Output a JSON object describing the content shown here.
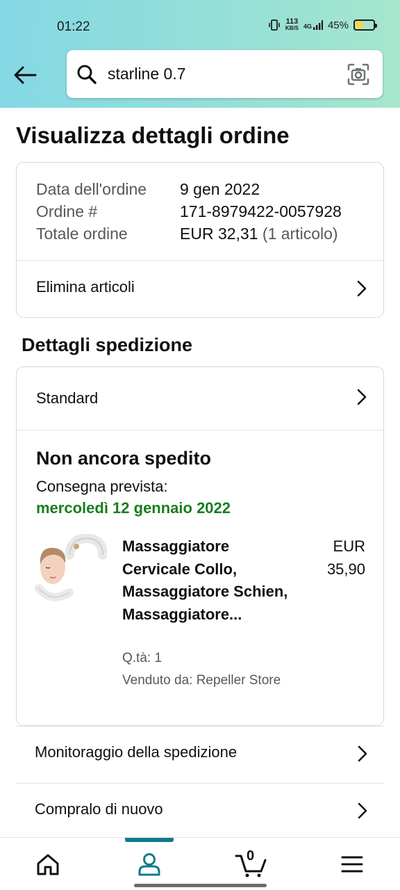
{
  "status_bar": {
    "time": "01:22",
    "speed_value": "113",
    "speed_unit": "KB/S",
    "network": "4G",
    "battery_percent": "45%",
    "battery_level": 0.45
  },
  "search": {
    "query": "starline 0.7"
  },
  "page": {
    "title": "Visualizza dettagli ordine"
  },
  "order_summary": {
    "date_label": "Data dell'ordine",
    "date_value": "9 gen 2022",
    "number_label": "Ordine #",
    "number_value": "171-8979422-0057928",
    "total_label": "Totale ordine",
    "total_value": "EUR 32,31",
    "total_items": "(1 articolo)",
    "delete_items_label": "Elimina articoli"
  },
  "shipping": {
    "section_title": "Dettagli spedizione",
    "method": "Standard",
    "status": "Non ancora spedito",
    "eta_label": "Consegna prevista:",
    "eta_date": "mercoledì 12 gennaio 2022",
    "product": {
      "title": "Massaggiatore Cervicale Collo, Massaggiatore Schien, Massaggiatore...",
      "price_currency": "EUR",
      "price_value": "35,90",
      "quantity": "Q.tà: 1",
      "seller": "Venduto da: Repeller Store"
    }
  },
  "actions": {
    "track_label": "Monitoraggio della spedizione",
    "buy_again_label": "Compralo di nuovo"
  },
  "bottom_nav": {
    "cart_count": "0",
    "active": "account"
  },
  "colors": {
    "header_gradient_start": "#84d8e4",
    "header_gradient_end": "#a6e6cd",
    "delivery_green": "#1a7d1f",
    "nav_accent": "#117a8b"
  }
}
